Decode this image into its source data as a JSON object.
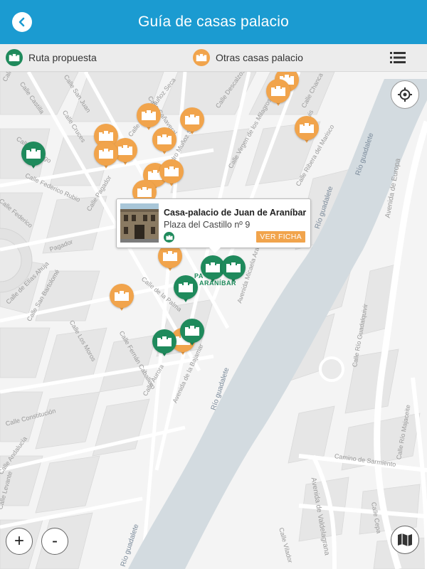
{
  "header": {
    "title": "Guía de casas palacio",
    "back_icon": "chevron-left-icon"
  },
  "legend": {
    "route_label": "Ruta propuesta",
    "others_label": "Otras casas palacio",
    "route_color": "#1f8a5c",
    "others_color": "#f1a44c"
  },
  "popup": {
    "title": "Casa-palacio de Juan de Araníbar",
    "address": "Plaza del Castillo nº 9",
    "button": "VER FICHA"
  },
  "controls": {
    "zoom_in": "+",
    "zoom_out": "-"
  },
  "map": {
    "streets": [
      "Calle Pureza",
      "Calle Castilla",
      "Calle San Juan",
      "Calle Cruces",
      "Calle Durango",
      "Calle Federico Rubio",
      "Calle Pagador",
      "Calle Cañaveral",
      "Calle Doctor Muñoz Seca",
      "Calle Pedro Muñoz Seca",
      "Calle Descalzos",
      "Calle Virgen de los Milagros",
      "Calle Chanca",
      "Calle Luis",
      "Calle Ribera del Marisco",
      "Calle de Elías Ahuja",
      "Calle San Bartolomé",
      "Calle Fernán Caballero",
      "Calle Los Moros",
      "Calle de la Palma",
      "Calle Aurora",
      "Avenida de la Bajamar",
      "Avenida Micaela Aramburu",
      "Calle Constitución",
      "Calle Andalucía",
      "Calle Levante",
      "Avenida de Europa",
      "Calle Río Guadalquivir",
      "Calle Río Majaceite",
      "Camino de Sarmiento",
      "Avenida de Valdelagrana",
      "Calle Cepa",
      "Calle Vilador",
      "Calle Federico",
      "Pagador"
    ],
    "river": [
      "Río guadalete",
      "Río guadalete",
      "Río guadalete",
      "Río guadalete"
    ],
    "place_label": "ARANÍBAR",
    "place_label_prefix": "PA"
  }
}
